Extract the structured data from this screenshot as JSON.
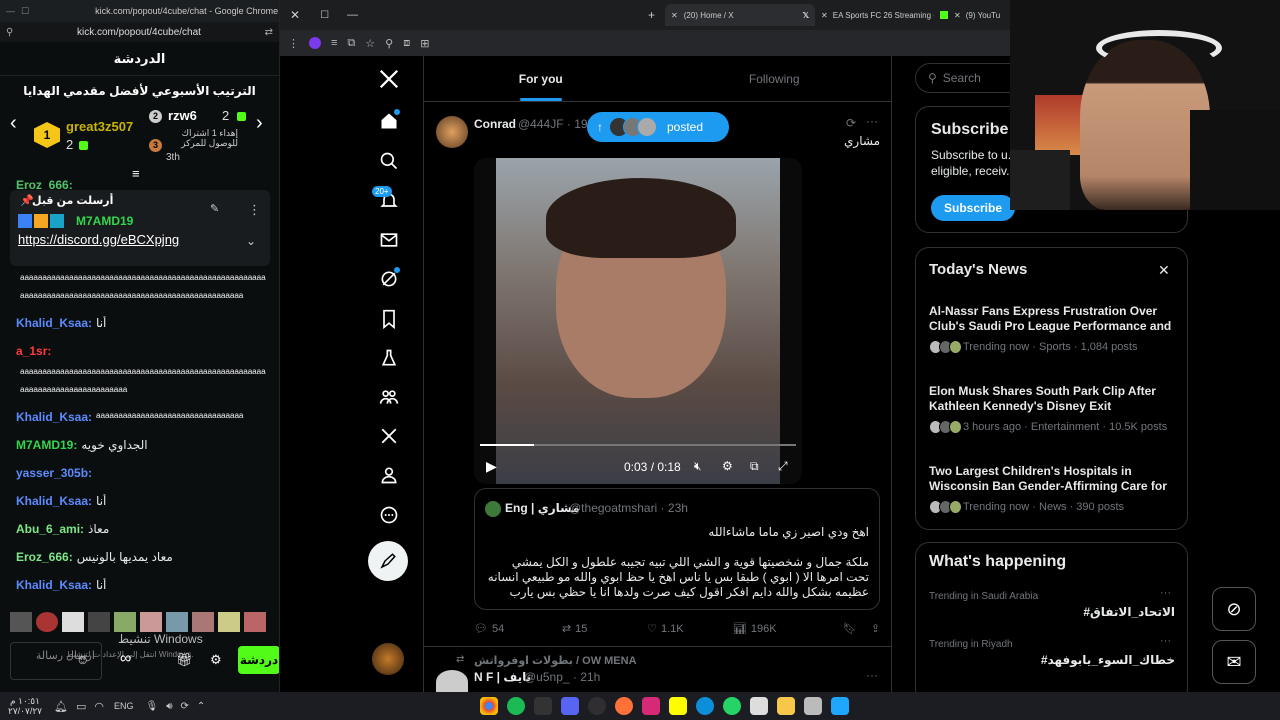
{
  "chat_window": {
    "title": "kick.com/popout/4cube/chat - Google Chrome",
    "url": "kick.com/popout/4cube/chat",
    "header": "الدردشة",
    "gifters_title": "الترتيب الأسبوعي لأفضل مقدمي الهدايا",
    "gifter_1_name": "great3z507",
    "gifter_1_count": "2",
    "gifter_1_rank": "1",
    "gifter_2_name": "rzw6",
    "gifter_2_count": "2",
    "gifter_2_rank": "2",
    "gifter_3_text": "إهداء 1 اشتراك للوصول للمركز",
    "gifter_3_rank": "3th",
    "behind_user": "Eroz_666:",
    "pinned_label": "أرسلت من قبل",
    "pinned_user": "M7AMD19",
    "pinned_link": "https://discord.gg/eBCXpjng",
    "messages": [
      {
        "text": "ᵃᵃᵃᵃᵃᵃᵃᵃᵃᵃᵃᵃᵃᵃᵃᵃᵃᵃᵃᵃᵃᵃᵃᵃᵃᵃᵃᵃᵃᵃᵃᵃᵃᵃᵃᵃᵃᵃᵃᵃᵃᵃᵃᵃᵃᵃᵃᵃᵃᵃᵃᵃᵃᵃᵃᵃᵃᵃ",
        "user": "",
        "color": "#ffffff"
      },
      {
        "text": "ᵃᵃᵃᵃᵃᵃᵃᵃᵃᵃᵃᵃᵃᵃᵃᵃᵃᵃᵃᵃᵃᵃᵃᵃᵃᵃᵃᵃᵃᵃᵃᵃᵃᵃᵃᵃᵃᵃᵃᵃᵃᵃᵃᵃᵃᵃᵃᵃᵃᵃ",
        "user": "",
        "color": "#ffffff"
      },
      {
        "user": "Khalid_Ksaa:",
        "text": "أنا",
        "color": "#5b8cff"
      },
      {
        "user": "a_1sr:",
        "text": "",
        "color": "#ff3b3b"
      },
      {
        "text": "ᵃᵃᵃᵃᵃᵃᵃᵃᵃᵃᵃᵃᵃᵃᵃᵃᵃᵃᵃᵃᵃᵃᵃᵃᵃᵃᵃᵃᵃᵃᵃᵃᵃᵃᵃᵃᵃᵃᵃᵃᵃᵃᵃᵃᵃᵃᵃᵃᵃᵃᵃᵃᵃᵃᵃᵃᵃᵃ",
        "user": "",
        "color": "#ffffff"
      },
      {
        "text": "ᵃᵃᵃᵃᵃᵃᵃᵃᵃᵃᵃᵃᵃᵃᵃᵃᵃᵃᵃᵃᵃᵃᵃᵃ",
        "user": "",
        "color": "#ffffff"
      },
      {
        "user": "Khalid_Ksaa:",
        "text": "ᵃᵃᵃᵃᵃᵃᵃᵃᵃᵃᵃᵃᵃᵃᵃᵃᵃᵃᵃᵃᵃᵃᵃᵃᵃᵃᵃᵃᵃᵃᵃᵃᵃ",
        "color": "#5b8cff"
      },
      {
        "user": "M7AMD19:",
        "text": "الجداوي خويه",
        "color": "#32d74b"
      },
      {
        "user": "yasser_305b:",
        "text": "",
        "color": "#5b8cff"
      },
      {
        "user": "Khalid_Ksaa:",
        "text": "أنا",
        "color": "#5b8cff"
      },
      {
        "user": "Abu_6_ami:",
        "text": "معاذ",
        "color": "#7ee787"
      },
      {
        "user": "Eroz_666:",
        "text": "معاد يمديها بالونيس",
        "color": "#7ee787"
      },
      {
        "user": "Khalid_Ksaa:",
        "text": "أنا",
        "color": "#5b8cff"
      }
    ],
    "windows_watermark": "تنشيط Windows",
    "windows_watermark_2": "انتقل إلى الإعدادات لتنشيط Windows.",
    "input_placeholder": "ارسال رسالة",
    "send_label": "دردشة"
  },
  "browser": {
    "tabs": [
      {
        "label": "(20) Home / X"
      },
      {
        "label": "EA Sports FC 26 Streaming - Li..."
      },
      {
        "label": "(9) YouTu"
      }
    ]
  },
  "x": {
    "nav_badge": "20+",
    "tab_for_you": "For you",
    "tab_following": "Following",
    "search_placeholder": "Search",
    "posted_pill": "posted",
    "post": {
      "author": "Conrad",
      "handle": "@444JF · 19h",
      "caption": "مشاري",
      "video_time": "0:03 / 0:18",
      "video_progress": 0.17,
      "quote_author": "Eng | مشاري",
      "quote_handle": "@thegoatmshari · 23h",
      "quote_line1": "اهخ ودي اصير زي ماما ماشاءالله",
      "quote_body": "ملكة جمال و شخصيتها قوية و الشي اللي تبيه تجيبه علطول و الكل يمشي تحت امرها الا ( ابوي ) طبقا بس يا ناس اهخ يا حظ ابوي والله مو طبيعي انسانه عظيمه بشكل والله دايم افكر اقول كيف صرت ولدها انا يا حظي بس يارب اتزوج وحده تشبـ...",
      "replies": "54",
      "reposts": "15",
      "likes": "1.1K",
      "views": "196K"
    },
    "next_post": {
      "context": "بطولات اوفرواتش / OW MENA",
      "author": "N F | نايف",
      "handle": "@u5np_ · 21h"
    },
    "subscribe": {
      "title": "Subscribe",
      "text": "Subscribe to u... eligible, receiv...",
      "button": "Subscribe"
    },
    "news": {
      "title": "Today's News",
      "items": [
        {
          "title": "Al-Nassr Fans Express Frustration Over Club's Saudi Pro League Performance and ...",
          "meta": "Trending now · Sports · 1,084 posts"
        },
        {
          "title": "Elon Musk Shares South Park Clip After Kathleen Kennedy's Disney Exit",
          "meta": "3 hours ago · Entertainment · 10.5K posts"
        },
        {
          "title": "Two Largest Children's Hospitals in Wisconsin Ban Gender-Affirming Care for ...",
          "meta": "Trending now · News · 390 posts"
        }
      ]
    },
    "happening": {
      "title": "What's happening",
      "items": [
        {
          "context": "Trending in Saudi Arabia",
          "tag": "#الاتحاد_الاتفاق"
        },
        {
          "context": "Trending in Riyadh",
          "tag": "#خطاك_السوء_يابوفهد"
        }
      ]
    }
  },
  "taskbar": {
    "lang": "ENG",
    "time": "١٠:٥١ م",
    "date": "٢٧/٠٧/٢٧"
  }
}
